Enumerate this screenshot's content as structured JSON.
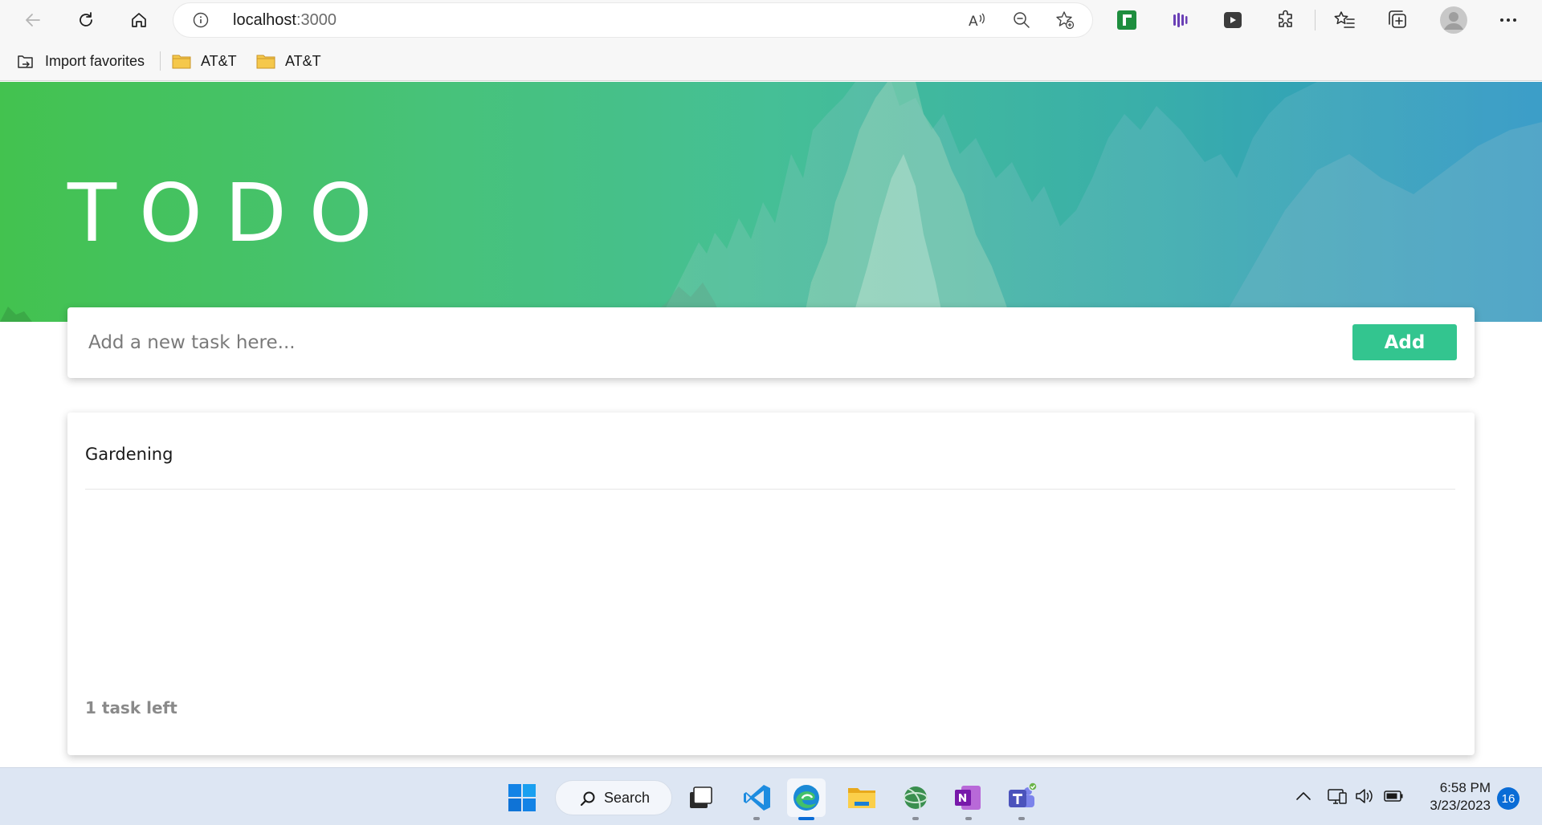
{
  "browser": {
    "url_host": "localhost",
    "url_port": ":3000",
    "favorites": [
      {
        "label": "Import favorites",
        "icon": "import-favorites-icon"
      },
      {
        "label": "AT&T",
        "icon": "folder-icon"
      },
      {
        "label": "AT&T",
        "icon": "folder-icon"
      }
    ]
  },
  "app": {
    "title": "TODO",
    "input_placeholder": "Add a new task here...",
    "input_value": "",
    "add_label": "Add",
    "tasks": [
      {
        "text": "Gardening"
      }
    ],
    "tasks_left": "1 task left"
  },
  "colors": {
    "accent": "#33c58f",
    "hero_start": "#43c24f",
    "hero_end": "#2b93c8"
  },
  "taskbar": {
    "search_label": "Search",
    "time": "6:58 PM",
    "date": "3/23/2023",
    "notification_count": "16",
    "apps": [
      "windows-start-icon",
      "task-view-icon",
      "vscode-icon",
      "edge-icon",
      "file-explorer-icon",
      "globe-app-icon",
      "onenote-icon",
      "teams-icon"
    ]
  }
}
